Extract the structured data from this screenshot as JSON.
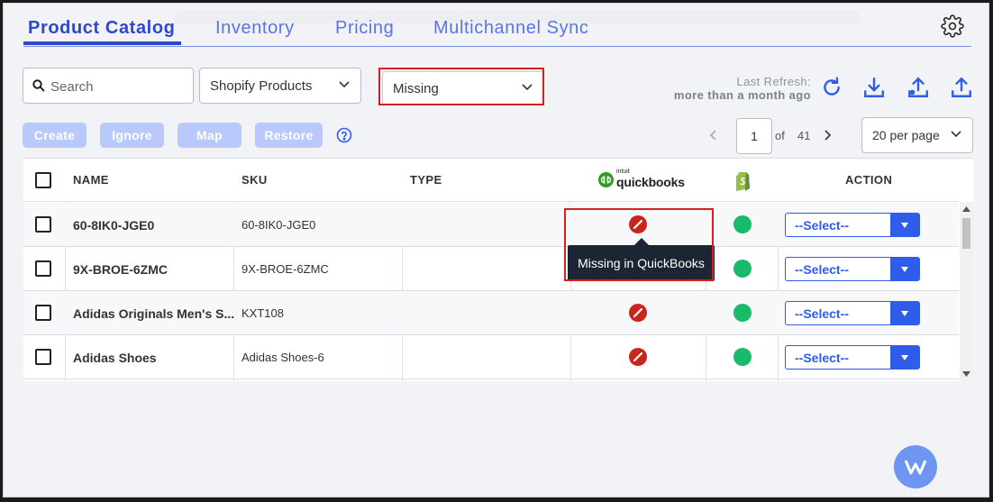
{
  "tabs": [
    {
      "label": "Product Catalog",
      "active": true
    },
    {
      "label": "Inventory",
      "active": false
    },
    {
      "label": "Pricing",
      "active": false
    },
    {
      "label": "Multichannel Sync",
      "active": false
    }
  ],
  "filters": {
    "search_placeholder": "Search",
    "source_select": "Shopify Products",
    "status_select": "Missing"
  },
  "refresh": {
    "label": "Last Refresh:",
    "value": "more than a month ago"
  },
  "actions": {
    "create": "Create",
    "ignore": "Ignore",
    "map": "Map",
    "restore": "Restore"
  },
  "pagination": {
    "current_page": "1",
    "of_label": "of",
    "total_pages": "41",
    "per_page": "20 per page"
  },
  "table": {
    "headers": {
      "name": "NAME",
      "sku": "SKU",
      "type": "TYPE",
      "quickbooks_logo": "quickbooks",
      "quickbooks_logo_small": "intuit",
      "action": "ACTION"
    },
    "rows": [
      {
        "name": "60-8IK0-JGE0",
        "sku": "60-8IK0-JGE0",
        "type": "",
        "action": "--Select--"
      },
      {
        "name": "9X-BROE-6ZMC",
        "sku": "9X-BROE-6ZMC",
        "type": "",
        "action": "--Select--"
      },
      {
        "name": "Adidas Originals Men's S...",
        "sku": "KXT108",
        "type": "",
        "action": "--Select--"
      },
      {
        "name": "Adidas Shoes",
        "sku": "Adidas Shoes-6",
        "type": "",
        "action": "--Select--"
      }
    ]
  },
  "tooltip": "Missing in QuickBooks",
  "colors": {
    "accent": "#2f47c9",
    "tab": "#5b73e8",
    "missing": "#c8261c",
    "synced": "#1aba6b",
    "select_blue": "#2f5ce8",
    "highlight": "#d61f1f"
  }
}
